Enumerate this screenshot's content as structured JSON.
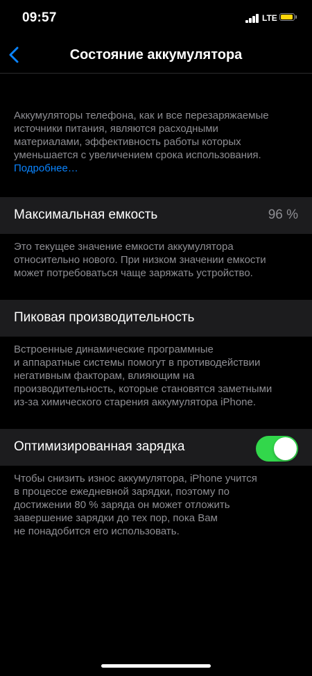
{
  "status_bar": {
    "time": "09:57",
    "network": "LTE",
    "battery_color": "#ffd60a"
  },
  "nav": {
    "title": "Состояние аккумулятора",
    "back_icon": "chevron-left-icon",
    "accent_color": "#0a84ff"
  },
  "intro": {
    "lines": [
      "Аккумуляторы телефона, как и все перезаряжаемые",
      "источники питания, являются расходными",
      "материалами, эффективность работы которых",
      "уменьшается с увеличением срока использования."
    ],
    "link": "Подробнее…"
  },
  "max_capacity": {
    "label": "Максимальная емкость",
    "value": "96 %",
    "description_lines": [
      "Это текущее значение емкости аккумулятора",
      "относительно нового. При низком значении емкости",
      "может потребоваться чаще заряжать устройство."
    ]
  },
  "peak_performance": {
    "label": "Пиковая производительность",
    "description_lines": [
      "Встроенные динамические программные",
      "и аппаратные системы помогут в противодействии",
      "негативным факторам, влияющим на",
      "производительность, которые становятся заметными",
      "из-за химического старения аккумулятора iPhone."
    ]
  },
  "optimized_charging": {
    "label": "Оптимизированная зарядка",
    "enabled": true,
    "toggle_color": "#32d74b",
    "description_lines": [
      "Чтобы снизить износ аккумулятора, iPhone учится",
      "в процессе ежедневной зарядки, поэтому по",
      "достижении 80 % заряда он может отложить",
      "завершение зарядки до тех пор, пока Вам",
      "не понадобится его использовать."
    ]
  }
}
